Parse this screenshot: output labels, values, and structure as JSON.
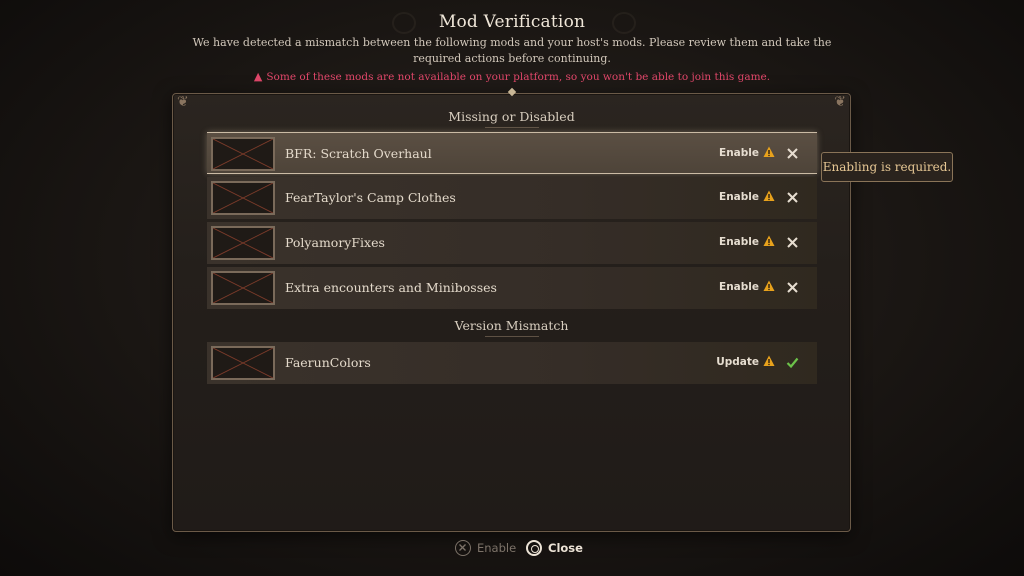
{
  "dialog": {
    "title": "Mod Verification",
    "subtitle": "We have detected a mismatch between the following mods and your host's mods. Please review them and take the required actions before continuing.",
    "platform_warning": "Some of these mods are not available on your platform, so you won't be able to join this game."
  },
  "sections": [
    {
      "heading": "Missing or Disabled",
      "mods": [
        {
          "name": "BFR: Scratch Overhaul",
          "action": "Enable",
          "status": "x-icon",
          "selected": true
        },
        {
          "name": "FearTaylor's Camp Clothes",
          "action": "Enable",
          "status": "x-icon",
          "selected": false
        },
        {
          "name": "PolyamoryFixes",
          "action": "Enable",
          "status": "x-icon",
          "selected": false
        },
        {
          "name": "Extra encounters and Minibosses",
          "action": "Enable",
          "status": "x-icon",
          "selected": false
        }
      ]
    },
    {
      "heading": "Version Mismatch",
      "mods": [
        {
          "name": "FaerunColors",
          "action": "Update",
          "status": "check-icon",
          "selected": false
        }
      ]
    }
  ],
  "tooltip": {
    "text": "Enabling is required."
  },
  "footer": {
    "enable_label": "Enable",
    "enable_icon": "cross-button-icon",
    "close_label": "Close",
    "close_icon": "circle-button-icon"
  },
  "colors": {
    "warning_red": "#e0476a",
    "warning_icon": "#e8a21c",
    "check_green": "#6cc24a",
    "tooltip_text": "#e6c794"
  }
}
